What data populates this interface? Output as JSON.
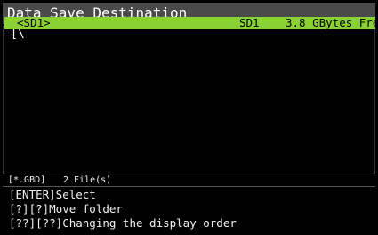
{
  "window": {
    "title": "Data Save Destination"
  },
  "browser": {
    "path": "[\\",
    "rows": [
      {
        "name": "<SD1>",
        "drive": "SD1",
        "free": "3.8 GBytes Fre",
        "selected": true
      }
    ]
  },
  "status": {
    "filter": "[*.GBD]",
    "file_count": "2 File(s)"
  },
  "help": {
    "lines": [
      "[ENTER]Select",
      "[?][?]Move folder",
      "[??][??]Changing the display order"
    ]
  },
  "colors": {
    "title_bar": "#4a4a4a",
    "selection": "#8ad135",
    "background": "#000000",
    "text": "#f2f2f2"
  }
}
